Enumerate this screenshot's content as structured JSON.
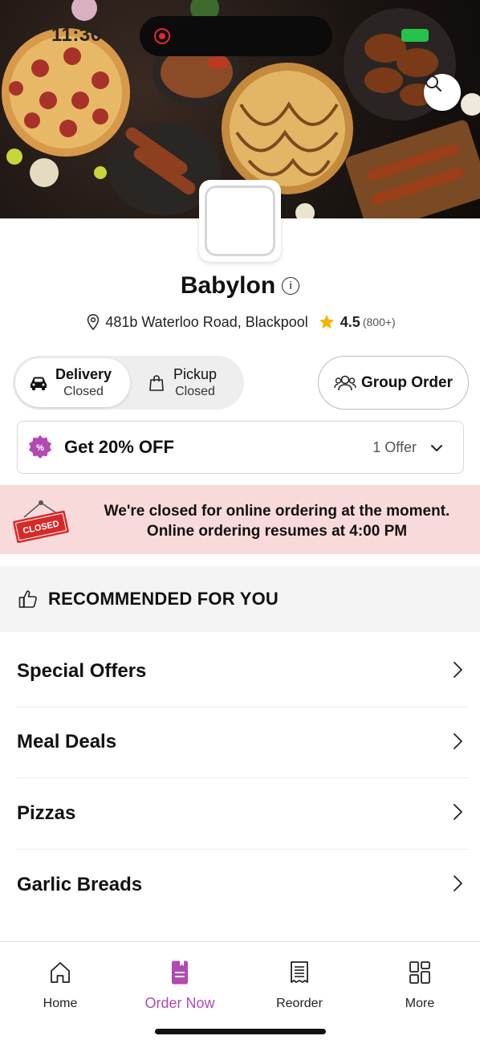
{
  "status": {
    "time": "11:36"
  },
  "restaurant": {
    "name": "Babylon",
    "address": "481b Waterloo Road, Blackpool",
    "rating": "4.5",
    "rating_count": "(800+)"
  },
  "modes": {
    "delivery": {
      "label": "Delivery",
      "status": "Closed"
    },
    "pickup": {
      "label": "Pickup",
      "status": "Closed"
    }
  },
  "group_order": {
    "label": "Group Order"
  },
  "offer": {
    "title": "Get 20% OFF",
    "count": "1 Offer"
  },
  "closed_notice": {
    "sign_text": "CLOSED",
    "line1": "We're closed for online ordering at the moment.",
    "line2": "Online ordering resumes at 4:00 PM"
  },
  "recommended": {
    "title": "RECOMMENDED FOR YOU"
  },
  "categories": [
    "Special Offers",
    "Meal Deals",
    "Pizzas",
    "Garlic Breads"
  ],
  "nav": [
    {
      "label": "Home",
      "icon": "home-icon"
    },
    {
      "label": "Order Now",
      "icon": "order-icon"
    },
    {
      "label": "Reorder",
      "icon": "receipt-icon"
    },
    {
      "label": "More",
      "icon": "grid-icon"
    }
  ],
  "colors": {
    "accent": "#b14ab1",
    "closed_bg": "#f9dada",
    "star": "#f5b400",
    "sign_red": "#d62a2a"
  }
}
